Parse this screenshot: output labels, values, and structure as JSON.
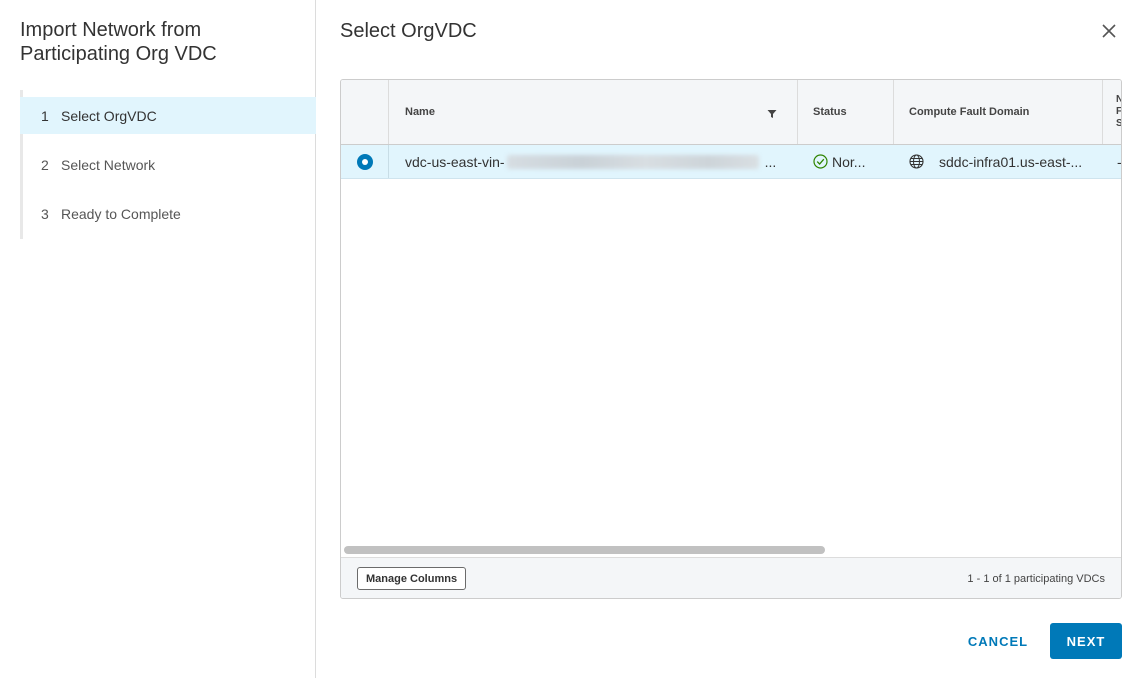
{
  "wizard": {
    "title": "Import Network from Participating Org VDC",
    "steps": [
      {
        "number": "1",
        "label": "Select OrgVDC",
        "active": true
      },
      {
        "number": "2",
        "label": "Select Network",
        "active": false
      },
      {
        "number": "3",
        "label": "Ready to Complete",
        "active": false
      }
    ]
  },
  "page": {
    "title": "Select OrgVDC",
    "close_icon": "close-icon"
  },
  "grid": {
    "columns": [
      {
        "label": "Name",
        "filter_icon": "filter-icon"
      },
      {
        "label": "Status"
      },
      {
        "label": "Compute Fault Domain"
      },
      {
        "label": "N F S"
      }
    ],
    "rows": [
      {
        "selected": true,
        "name_visible": "vdc-us-east-vin-",
        "name_ellipsis": "...",
        "status_icon": "check-circle-icon",
        "status": "Nor...",
        "domain_icon": "globe-icon",
        "fault_domain": "sddc-infra01.us-east-...",
        "last_col": "-"
      }
    ],
    "manage_columns_label": "Manage Columns",
    "pagination": "1 - 1 of 1 participating VDCs"
  },
  "actions": {
    "cancel": "CANCEL",
    "next": "NEXT"
  },
  "colors": {
    "accent": "#0079b8",
    "selected_row": "#e1f5fd",
    "status_ok": "#2f8400"
  }
}
